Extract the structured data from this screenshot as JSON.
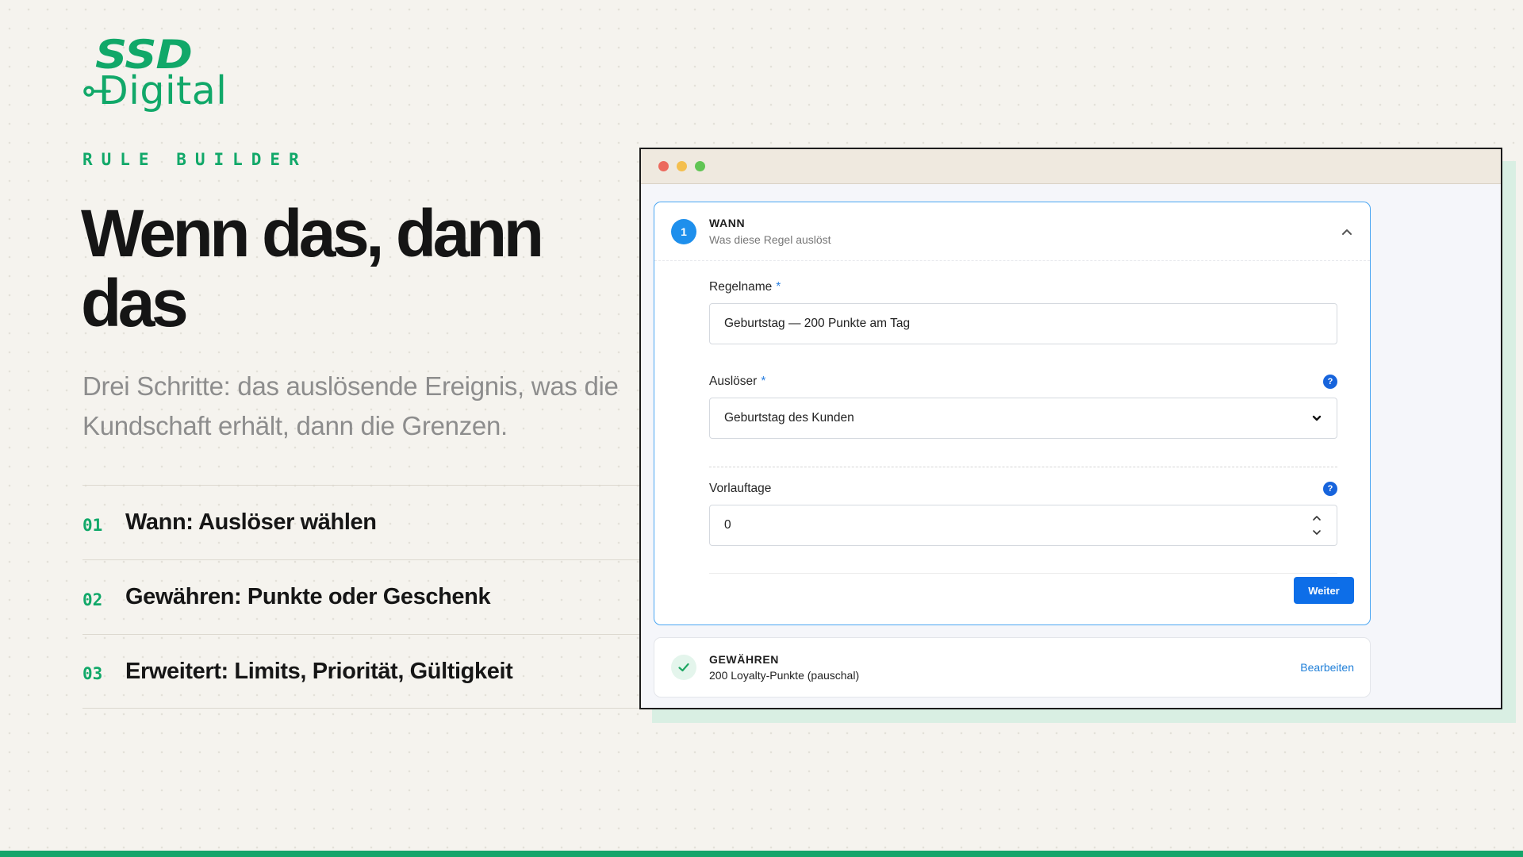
{
  "brand": {
    "logo_top": "SSD",
    "logo_bottom": "Digital",
    "accent_color": "#11a869"
  },
  "hero": {
    "eyebrow": "RULE BUILDER",
    "headline": "Wenn das, dann das",
    "subline": "Drei Schritte: das auslösende Ereignis, was die Kundschaft erhält, dann die Grenzen."
  },
  "steps": [
    {
      "num": "01",
      "label": "Wann: Auslöser wählen"
    },
    {
      "num": "02",
      "label": "Gewähren: Punkte oder Geschenk"
    },
    {
      "num": "03",
      "label": "Erweitert: Limits, Priorität, Gültigkeit"
    }
  ],
  "app": {
    "window_controls": [
      "close-dot",
      "minimize-dot",
      "maximize-dot"
    ],
    "step1": {
      "number": "1",
      "title": "WANN",
      "subtitle": "Was diese Regel auslöst",
      "collapse_icon": "chevron-up-icon",
      "fields": {
        "rule_name": {
          "label": "Regelname",
          "required_mark": "*",
          "value": "Geburtstag — 200 Punkte am Tag"
        },
        "trigger": {
          "label": "Auslöser",
          "required_mark": "*",
          "help": "?",
          "selected": "Geburtstag des Kunden"
        },
        "lead_days": {
          "label": "Vorlauftage",
          "help": "?",
          "value": "0"
        }
      },
      "next_button": "Weiter"
    },
    "step2": {
      "title": "GEWÄHREN",
      "summary": "200 Loyalty-Punkte (pauschal)",
      "edit_link": "Bearbeiten",
      "status_icon": "checkmark-icon"
    }
  },
  "colors": {
    "primary_blue": "#0d6ee8",
    "active_border": "#4aa6f2",
    "accent_green": "#11a869"
  }
}
